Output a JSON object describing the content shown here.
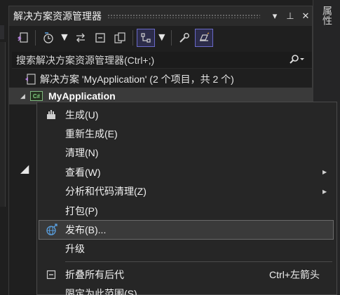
{
  "panel": {
    "title": "解决方案资源管理器",
    "title_buttons": [
      "▾",
      "⊥",
      "✕"
    ],
    "search_placeholder": "搜索解决方案资源管理器(Ctrl+;)"
  },
  "toolbar": {
    "icons": [
      "vs-switch-views-icon",
      "history-icon",
      "sync-icon",
      "collapse-all-icon",
      "show-all-files-icon",
      "filter-icon",
      "properties-wrench-icon",
      "preview-icon"
    ]
  },
  "tree": {
    "solution_label": "解决方案 'MyApplication' (2 个项目，共 2 个)",
    "project_label": "MyApplication",
    "project_badge": "C#"
  },
  "properties_tab": "属性",
  "context_menu": {
    "items": [
      {
        "label": "生成(U)",
        "icon": "build-icon",
        "submenu": false,
        "shortcut": ""
      },
      {
        "label": "重新生成(E)",
        "icon": "",
        "submenu": false,
        "shortcut": ""
      },
      {
        "label": "清理(N)",
        "icon": "",
        "submenu": false,
        "shortcut": ""
      },
      {
        "label": "查看(W)",
        "icon": "",
        "submenu": true,
        "shortcut": ""
      },
      {
        "label": "分析和代码清理(Z)",
        "icon": "",
        "submenu": true,
        "shortcut": ""
      },
      {
        "label": "打包(P)",
        "icon": "",
        "submenu": false,
        "shortcut": ""
      },
      {
        "label": "发布(B)...",
        "icon": "publish-globe-icon",
        "submenu": false,
        "shortcut": "",
        "highlighted": true
      },
      {
        "label": "升级",
        "icon": "",
        "submenu": false,
        "shortcut": ""
      },
      {
        "label": "折叠所有后代",
        "icon": "collapse-descendants-icon",
        "submenu": false,
        "shortcut": "Ctrl+左箭头"
      },
      {
        "label": "限定为此范围(S)",
        "icon": "",
        "submenu": false,
        "shortcut": ""
      }
    ]
  },
  "colors": {
    "panel_bg": "#1f1f1f",
    "menu_bg": "#262626",
    "highlight": "#3a3a3a",
    "selected_tool_border": "#6a6ac8",
    "project_badge": "#7fd17f"
  }
}
